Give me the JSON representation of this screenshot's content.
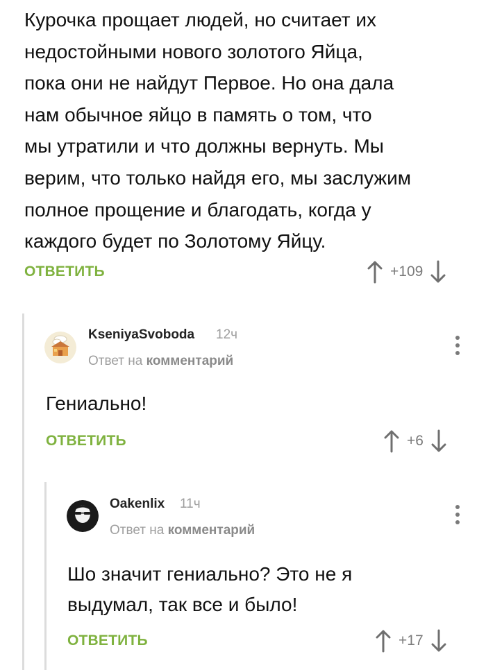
{
  "root_comment": {
    "text": "Курочка прощает людей, но считает их\nнедостойными нового золотого Яйца,\nпока они не найдут Первое. Но она дала\nнам обычное яйцо в память о том, что\nмы утратили и что должны вернуть. Мы\nверим, что только найдя его, мы заслужим\nполное прощение и благодать, когда у\nкаждого будет по Золотому Яйцу.",
    "reply_label": "ОТВЕТИТЬ",
    "votes": "+109"
  },
  "comments": [
    {
      "username": "KseniyaSvoboda",
      "time": "12ч",
      "reply_to_prefix": "Ответ на",
      "reply_to_link": "комментарий",
      "text": "Гениально!",
      "reply_label": "ОТВЕТИТЬ",
      "votes": "+6",
      "avatar_icon": "house-avatar-icon"
    },
    {
      "username": "Oakenlix",
      "time": "11ч",
      "reply_to_prefix": "Ответ на",
      "reply_to_link": "комментарий",
      "text_line1": "Шо значит гениально? Это не я",
      "text_line2": "выдумал, так все и было!",
      "reply_label": "ОТВЕТИТЬ",
      "votes": "+17",
      "avatar_icon": "bearded-man-avatar-icon"
    }
  ],
  "colors": {
    "accent_green": "#7fb23f",
    "meta_gray": "#9e9e9e",
    "thread_line": "#dcdcdc"
  }
}
